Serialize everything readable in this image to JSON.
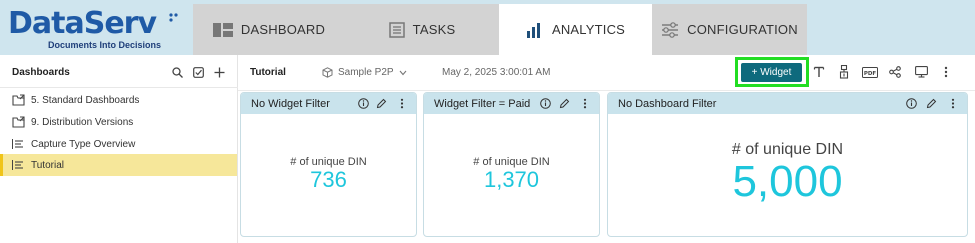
{
  "brand": {
    "name": "DataServ",
    "tagline": "Documents Into Decisions",
    "primary_color": "#1f5aa6",
    "accent_color": "#0e6a7d"
  },
  "nav": {
    "tabs": [
      {
        "label": "DASHBOARD",
        "icon": "dashboard-icon",
        "active": false
      },
      {
        "label": "TASKS",
        "icon": "tasks-icon",
        "active": false
      },
      {
        "label": "ANALYTICS",
        "icon": "bar-chart-icon",
        "active": true
      },
      {
        "label": "CONFIGURATION",
        "icon": "sliders-icon",
        "active": false
      }
    ]
  },
  "sidebar": {
    "title": "Dashboards",
    "actions": [
      "search-icon",
      "checkbox-icon",
      "plus-icon"
    ],
    "items": [
      {
        "label": "5. Standard Dashboards",
        "icon": "folder-share-icon",
        "selected": false
      },
      {
        "label": "9. Distribution Versions",
        "icon": "folder-share-icon",
        "selected": false
      },
      {
        "label": "Capture Type Overview",
        "icon": "list-icon",
        "selected": false
      },
      {
        "label": "Tutorial",
        "icon": "list-icon",
        "selected": true
      }
    ]
  },
  "toolbar": {
    "title": "Tutorial",
    "datasource": "Sample P2P",
    "date": "May 2, 2025 3:00:01 AM",
    "widget_button": "+ Widget",
    "highlight_color": "#22dd22"
  },
  "widgets": [
    {
      "title": "No Widget Filter",
      "label": "# of unique DIN",
      "value": "736"
    },
    {
      "title": "Widget Filter = Paid",
      "label": "# of unique DIN",
      "value": "1,370"
    },
    {
      "title": "No Dashboard Filter",
      "label": "# of unique DIN",
      "value": "5,000"
    }
  ],
  "metric_color": "#1ec6dc"
}
